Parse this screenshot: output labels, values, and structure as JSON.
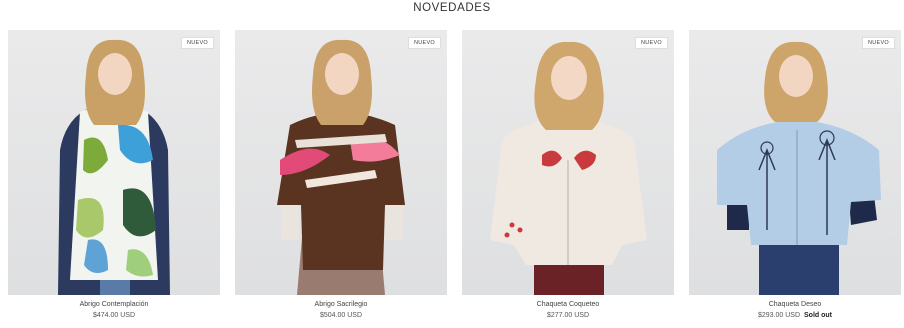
{
  "section": {
    "title": "NOVEDADES"
  },
  "products": [
    {
      "name": "Abrigo Contemplación",
      "price": "$474.00 USD",
      "badge": "NUEVO",
      "sold_out": ""
    },
    {
      "name": "Abrigo Sacrilegio",
      "price": "$504.00 USD",
      "badge": "NUEVO",
      "sold_out": ""
    },
    {
      "name": "Chaqueta Coqueteo",
      "price": "$277.00 USD",
      "badge": "NUEVO",
      "sold_out": ""
    },
    {
      "name": "Chaqueta Deseo",
      "price": "$293.00 USD",
      "badge": "NUEVO",
      "sold_out": "Sold out"
    }
  ]
}
